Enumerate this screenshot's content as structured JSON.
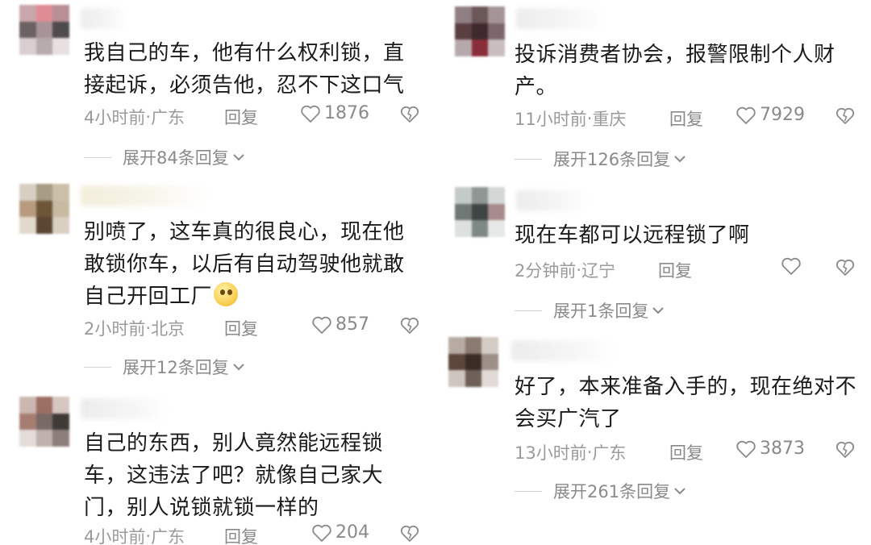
{
  "left": [
    {
      "text": "我自己的车，他有什么权利锁，直接起诉，必须告他，忍不下这口气",
      "time": "4小时前",
      "location": "广东",
      "reply": "回复",
      "likes": "1876",
      "expand": "展开84条回复"
    },
    {
      "text": "别喷了，这车真的很良心，现在他敢锁你车，以后有自动驾驶他就敢自己开回工厂",
      "time": "2小时前",
      "location": "北京",
      "reply": "回复",
      "likes": "857",
      "expand": "展开12条回复"
    },
    {
      "text": "自己的东西，别人竟然能远程锁车，这违法了吧？就像自己家大门，别人说锁就锁一样的",
      "time": "4小时前",
      "location": "广东",
      "reply": "回复",
      "likes": "204"
    }
  ],
  "right": [
    {
      "text": "投诉消费者协会，报警限制个人财产。",
      "time": "11小时前",
      "location": "重庆",
      "reply": "回复",
      "likes": "7929",
      "expand": "展开126条回复"
    },
    {
      "text": "现在车都可以远程锁了啊",
      "time": "2分钟前",
      "location": "辽宁",
      "reply": "回复",
      "likes": "",
      "expand": "展开1条回复"
    },
    {
      "text": "好了，本来准备入手的，现在绝对不会买广汽了",
      "time": "13小时前",
      "location": "广东",
      "reply": "回复",
      "likes": "3873",
      "expand": "展开261条回复"
    }
  ],
  "separator": " · ",
  "colors": {
    "meta": "#9a9a9a",
    "text": "#1b1b1b",
    "line": "#d4d4d4"
  },
  "icons": {
    "like": "heart-outline-icon",
    "dislike": "broken-heart-icon",
    "expand": "chevron-down-icon"
  }
}
